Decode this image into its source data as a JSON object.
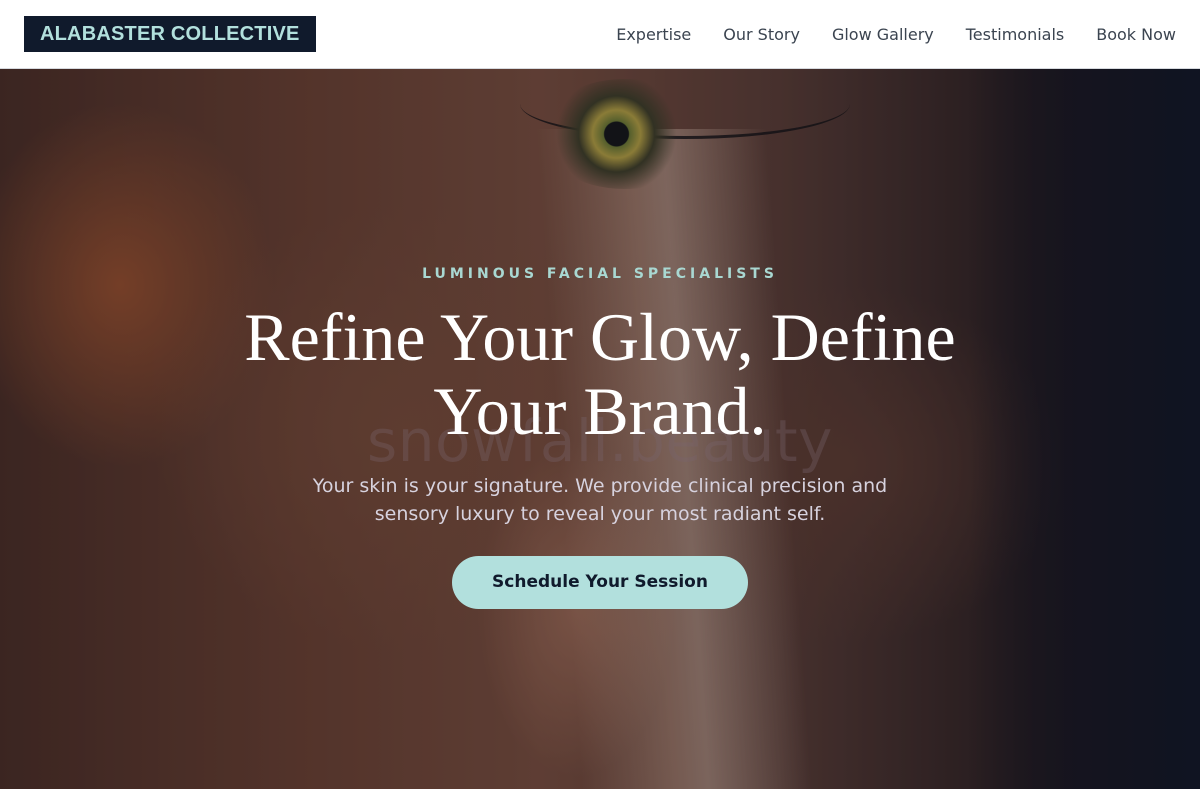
{
  "header": {
    "logo": "ALABASTER COLLECTIVE",
    "nav": [
      "Expertise",
      "Our Story",
      "Glow Gallery",
      "Testimonials",
      "Book Now"
    ]
  },
  "hero": {
    "eyebrow": "LUMINOUS FACIAL SPECIALISTS",
    "headline": "Refine Your Glow, Define Your Brand.",
    "subtext": "Your skin is your signature. We provide clinical precision and sensory luxury to reveal your most radiant self.",
    "cta": "Schedule Your Session",
    "watermark": "snowfall.beauty"
  },
  "colors": {
    "brand_dark": "#101a2c",
    "accent_teal": "#b2e0dd",
    "eyebrow_teal": "#a9d8d2"
  }
}
